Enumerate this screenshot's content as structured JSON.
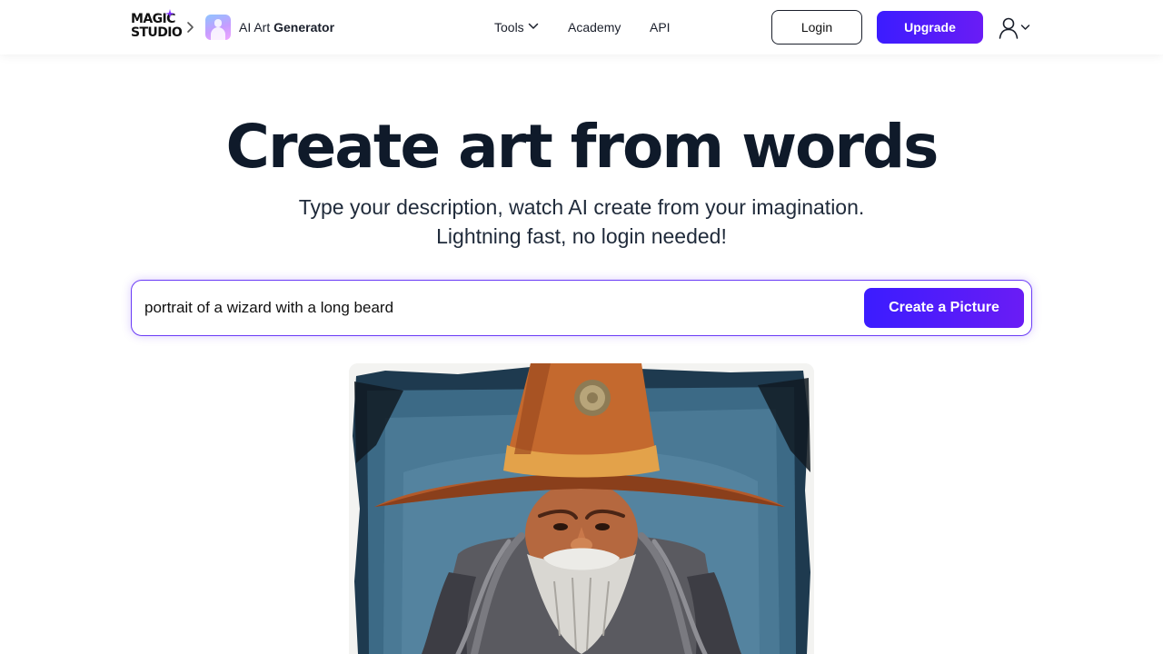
{
  "header": {
    "logo": {
      "line1": "MAGIC",
      "line2": "STUDIO"
    },
    "app": {
      "prefix": "AI Art",
      "name": "Generator"
    },
    "nav": [
      {
        "label": "Tools"
      },
      {
        "label": "Academy"
      },
      {
        "label": "API"
      }
    ],
    "login_label": "Login",
    "upgrade_label": "Upgrade"
  },
  "hero": {
    "title": "Create art from words",
    "subtitle_line1": "Type your description, watch AI create from your imagination.",
    "subtitle_line2": "Lightning fast, no login needed!"
  },
  "prompt": {
    "value": "portrait of a wizard with a long beard",
    "button_label": "Create a Picture"
  },
  "colors": {
    "accent": "#4a1cff",
    "accent_end": "#6a1cf5",
    "text": "#0f1a2a"
  },
  "icons": [
    "sparkle-icon",
    "chevron-right-icon",
    "chevron-down-icon",
    "user-icon"
  ]
}
